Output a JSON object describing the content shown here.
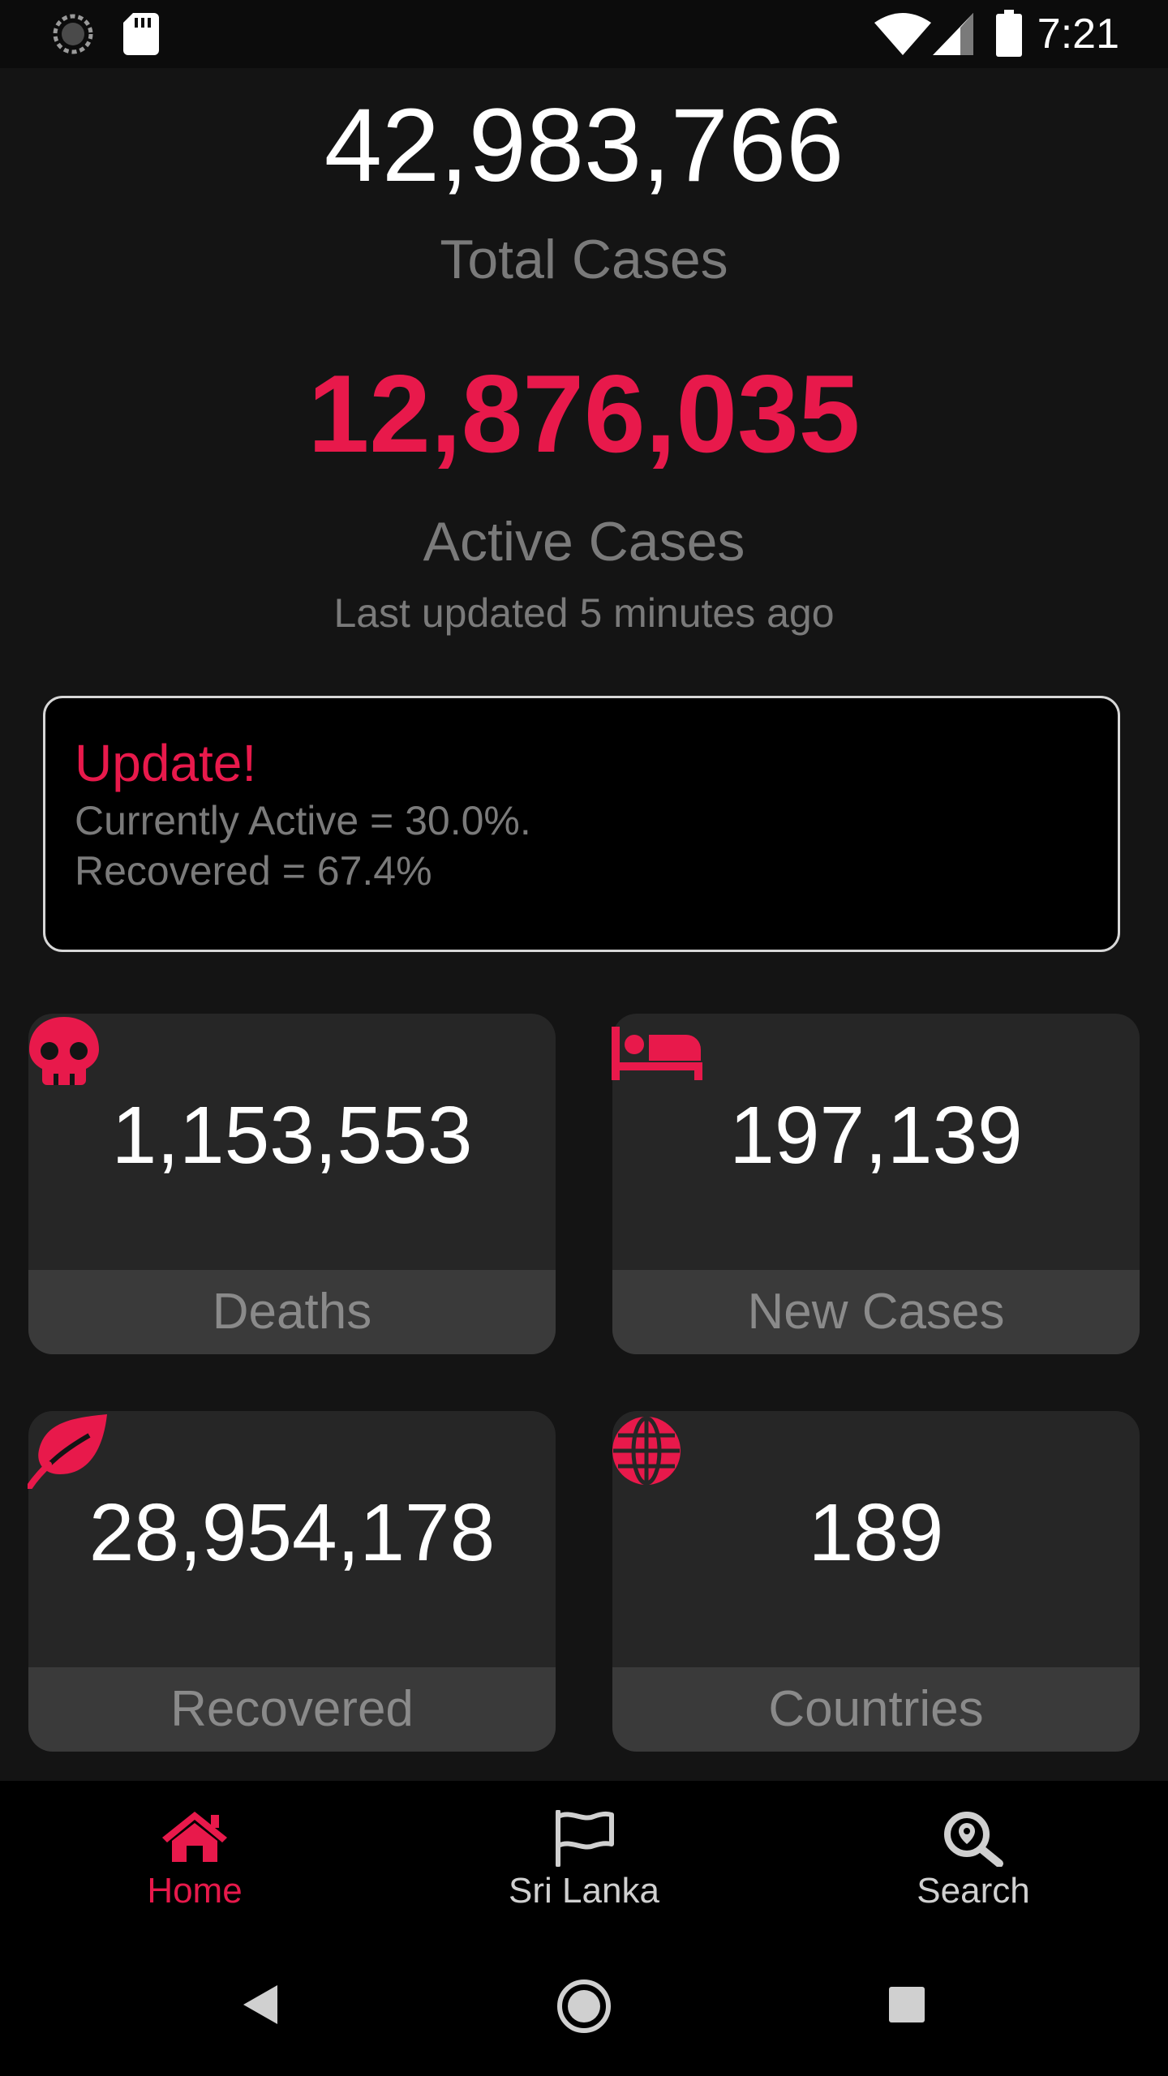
{
  "status_bar": {
    "time": "7:21",
    "icons": [
      "loading-icon",
      "sd-card-icon",
      "wifi-icon",
      "cell-signal-icon",
      "battery-icon"
    ]
  },
  "summary": {
    "total_cases": "42,983,766",
    "total_label": "Total Cases",
    "active_cases": "12,876,035",
    "active_label": "Active Cases",
    "last_updated": "Last updated 5 minutes ago"
  },
  "update_card": {
    "title": "Update!",
    "line1": "Currently Active = 30.0%.",
    "line2": "Recovered = 67.4%"
  },
  "stats": [
    {
      "value": "1,153,553",
      "label": "Deaths",
      "icon": "skull-icon"
    },
    {
      "value": "197,139",
      "label": "New Cases",
      "icon": "bed-icon"
    },
    {
      "value": "28,954,178",
      "label": "Recovered",
      "icon": "leaf-icon"
    },
    {
      "value": "189",
      "label": "Countries",
      "icon": "globe-icon"
    }
  ],
  "bottom_nav": {
    "items": [
      {
        "label": "Home",
        "icon": "home-icon",
        "active": true
      },
      {
        "label": "Sri Lanka",
        "icon": "flag-icon",
        "active": false
      },
      {
        "label": "Search",
        "icon": "search-location-icon",
        "active": false
      }
    ]
  },
  "colors": {
    "accent": "#e8194b",
    "background": "#141414",
    "card": "#262626",
    "card_footer": "#3a3a3a",
    "muted_text": "#7a7a7a"
  }
}
